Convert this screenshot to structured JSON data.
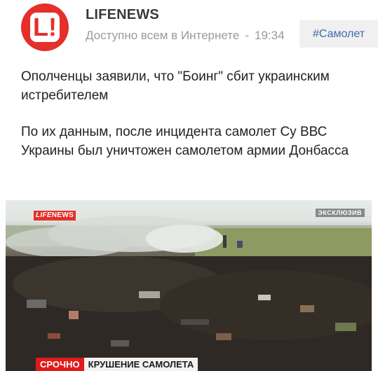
{
  "post": {
    "author": "LIFENEWS",
    "visibility": "Доступно всем в Интернете",
    "separator": "-",
    "time": "19:34",
    "hashtag": "#Самолет",
    "paragraphs": [
      "Ополченцы заявили, что \"Боинг\" сбит украинским истребителем",
      "По их данным, после инцидента самолет Су ВВС Украины был уничтожен самолетом армии Донбасса"
    ]
  },
  "avatar": {
    "glyph": "L!",
    "color": "#e52f2a"
  },
  "media": {
    "logo_life": "LIFE",
    "logo_news": "NEWS",
    "exclusive": "ЭКСКЛЮЗИВ",
    "ticker_urgent": "СРОЧНО",
    "ticker_headline": "КРУШЕНИЕ САМОЛЕТА"
  },
  "colors": {
    "brand_red": "#e52f2a",
    "hashtag_blue": "#3f6ab0",
    "meta_gray": "#9a9a9a"
  }
}
